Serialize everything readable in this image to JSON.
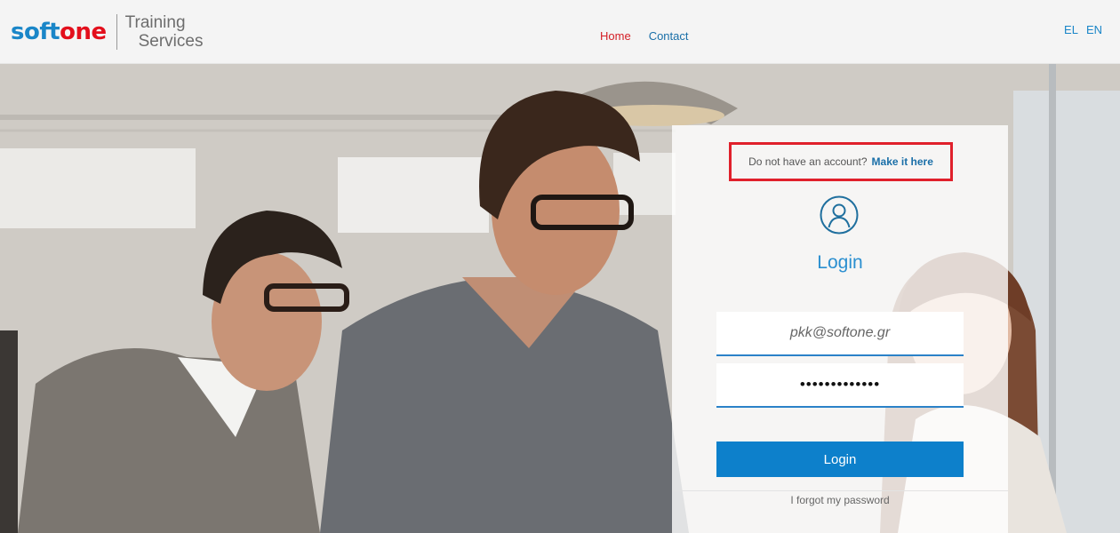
{
  "header": {
    "logo": {
      "soft": "soft",
      "one": "one",
      "line1": "Training",
      "line2": "Services"
    },
    "nav": [
      {
        "label": "Home",
        "color": "#d41f26"
      },
      {
        "label": "Contact",
        "color": "#1a6fa8"
      }
    ],
    "languages": [
      "EL",
      "EN"
    ]
  },
  "login_panel": {
    "signup_prompt": "Do not have an account?",
    "signup_link": "Make it here",
    "title": "Login",
    "email_value": "pkk@softone.gr",
    "password_value": "•••••••••••••",
    "button_label": "Login",
    "forgot_link": "I forgot my password",
    "icons": [
      "user-circle-icon"
    ]
  },
  "colors": {
    "brand_blue": "#1a86c8",
    "brand_red": "#e30f1c",
    "button_blue": "#0d80cb",
    "highlight_red": "#e0202b"
  }
}
